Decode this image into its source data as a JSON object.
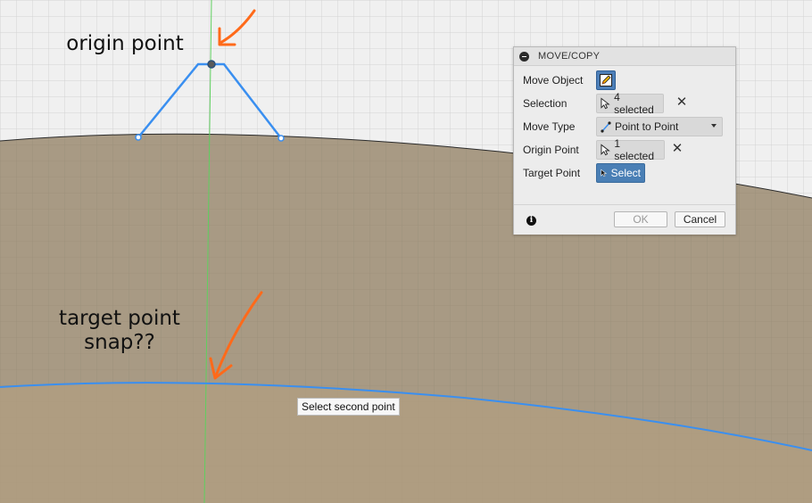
{
  "annotations": {
    "origin": "origin point",
    "target_line1": "target point",
    "target_line2": "snap??"
  },
  "dialog": {
    "title": "MOVE/COPY",
    "rows": {
      "move_object": {
        "label": "Move Object"
      },
      "selection": {
        "label": "Selection",
        "value": "4 selected"
      },
      "move_type": {
        "label": "Move Type",
        "value": "Point to Point"
      },
      "origin_point": {
        "label": "Origin Point",
        "value": "1 selected"
      },
      "target_point": {
        "label": "Target Point",
        "value": "Select"
      }
    },
    "ok_label": "OK",
    "cancel_label": "Cancel",
    "info_glyph": "i"
  },
  "tooltip": "Select second point",
  "colors": {
    "sketch_line": "#3a8ff0",
    "annotation_arrow": "#ff6a1a",
    "axis_green": "#5fcf5f",
    "body_fill": "#a89a84",
    "canvas_bg": "#f0f0f0"
  }
}
